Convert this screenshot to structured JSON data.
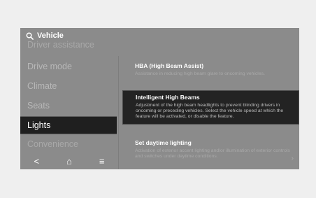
{
  "header": {
    "title": "Vehicle",
    "icon": "search-icon"
  },
  "sidebar": {
    "items": [
      {
        "label": "Driver assistance"
      },
      {
        "label": "Drive mode"
      },
      {
        "label": "Climate"
      },
      {
        "label": "Seats"
      },
      {
        "label": "Lights"
      },
      {
        "label": "Convenience"
      }
    ],
    "active_index": 4
  },
  "bottom_bar": {
    "back": "<",
    "home": "⌂",
    "menu": "≡"
  },
  "options": [
    {
      "title": "HBA (High Beam Assist)",
      "desc": "Assistance in reducing high beam glare to oncoming vehicles."
    },
    {
      "title": "Intelligent High Beams",
      "desc": "Adjustment of the high beam headlights to prevent blinding drivers in oncoming or preceding vehicles. Select the vehicle speed at which the feature will be activated, or disable the feature."
    },
    {
      "title": "Set daytime lighting",
      "desc": "Activation of exterior accent lighting and/or illumination of exterior controls and switches under daytime conditions.",
      "chevron": "›"
    }
  ]
}
